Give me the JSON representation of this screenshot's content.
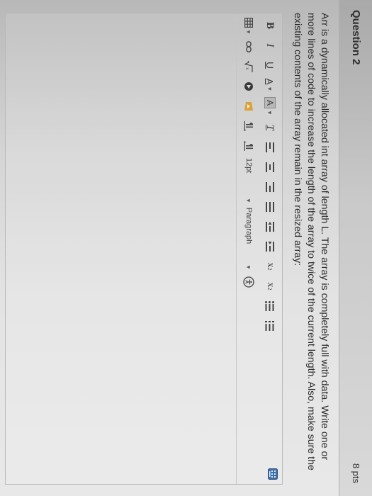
{
  "question": {
    "title": "Question 2",
    "points": "8 pts",
    "text": "Arr is a dynamically allocated int array of length L. The array is completely full with data. Write one or more lines of code to increase the length of the array to twice of the current length. Also, make sure the existing contents of the array remain in the resized array:"
  },
  "toolbar": {
    "bold": "B",
    "italic": "I",
    "underline": "U",
    "font_color": "A",
    "bg_color": "A",
    "clear_format": "T",
    "superscript": "x",
    "subscript": "x",
    "font_size": "12pt",
    "paragraph": "Paragraph"
  },
  "icons": [
    "bold-icon",
    "italic-icon",
    "underline-icon",
    "font-color-icon",
    "highlight-color-icon",
    "clear-formatting-icon",
    "align-left-icon",
    "align-center-icon",
    "align-right-icon",
    "align-justify-icon",
    "outdent-icon",
    "indent-icon",
    "superscript-icon",
    "subscript-icon",
    "bulleted-list-icon",
    "numbered-list-icon",
    "table-icon",
    "link-icon",
    "math-icon",
    "embed-icon",
    "media-icon",
    "ltr-icon",
    "rtl-icon",
    "accessibility-icon",
    "keyboard-icon"
  ]
}
